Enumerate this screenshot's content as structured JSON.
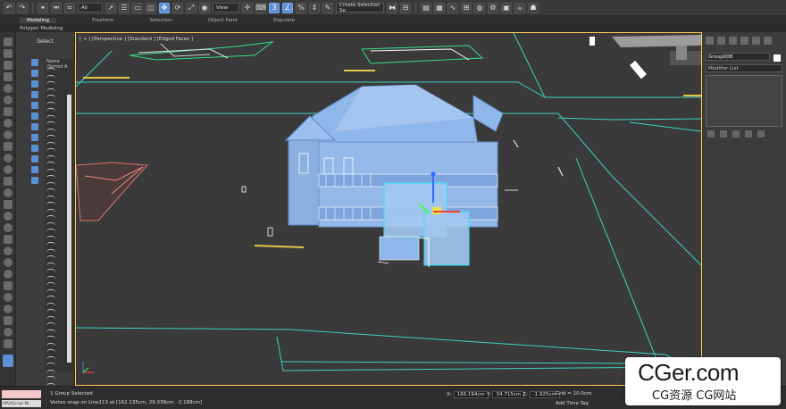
{
  "toolbar": {
    "filter_value": "All",
    "refcoord_value": "View",
    "selection_set_value": "Create Selection Se",
    "icons": [
      "undo-icon",
      "redo-icon",
      "link-icon",
      "unlink-icon",
      "bind-spacewarp-icon",
      "filter-dropdown",
      "select-icon",
      "select-by-name-icon",
      "rect-region-icon",
      "window-crossing-icon",
      "move-icon",
      "rotate-icon",
      "scale-icon",
      "place-icon",
      "refcoord-dropdown",
      "pivot-icon",
      "keyboard-shortcut-icon",
      "snap-3d-icon",
      "angle-snap-icon",
      "percent-snap-icon",
      "spinner-snap-icon",
      "edit-named-sel-icon",
      "selection-set-dropdown",
      "mirror-icon",
      "align-icon",
      "layer-explorer-icon",
      "toggle-ribbon-icon",
      "curve-editor-icon",
      "schematic-view-icon",
      "material-editor-icon",
      "render-setup-icon",
      "rendered-frame-icon",
      "render-icon",
      "render-production-icon"
    ]
  },
  "ribbon": {
    "tabs": [
      "Modeling",
      "Freeform",
      "Selection",
      "Object Paint",
      "Populate"
    ],
    "active_tab": "Modeling",
    "sub_label": "Polygon Modeling"
  },
  "explorer": {
    "title": "Select",
    "sort_label": "Name (Sorted A"
  },
  "viewport": {
    "label": "[ + ] [Perspective ] [Standard ] [Edged Faces ]"
  },
  "rightpanel": {
    "object_name": "Group008",
    "modifier_list": "Modifier List",
    "swatch_color": "#ffffff"
  },
  "status": {
    "maxscript": "MAXScript Mi",
    "selected": "1 Group Selected",
    "snap_info": "Vertex snap on Line113 at [162.135cm, 29.338cm, -2.188cm]",
    "x_label": "X:",
    "x_value": "166.194cm",
    "y_label": "Y:",
    "y_value": "34.715cm",
    "z_label": "Z:",
    "z_value": "-1.925cm",
    "grid": "Grid = 10.0cm",
    "time_tag": "Add Time Tag"
  },
  "watermark": {
    "title": "CGer.com",
    "subtitle": "CG资源 CG网站"
  },
  "colors": {
    "selection_yellow": "#ffcf4a",
    "grid_cyan": "#3fd1c2",
    "house_blue": "#8fb7ea",
    "active_blue": "#5b8fd6"
  }
}
